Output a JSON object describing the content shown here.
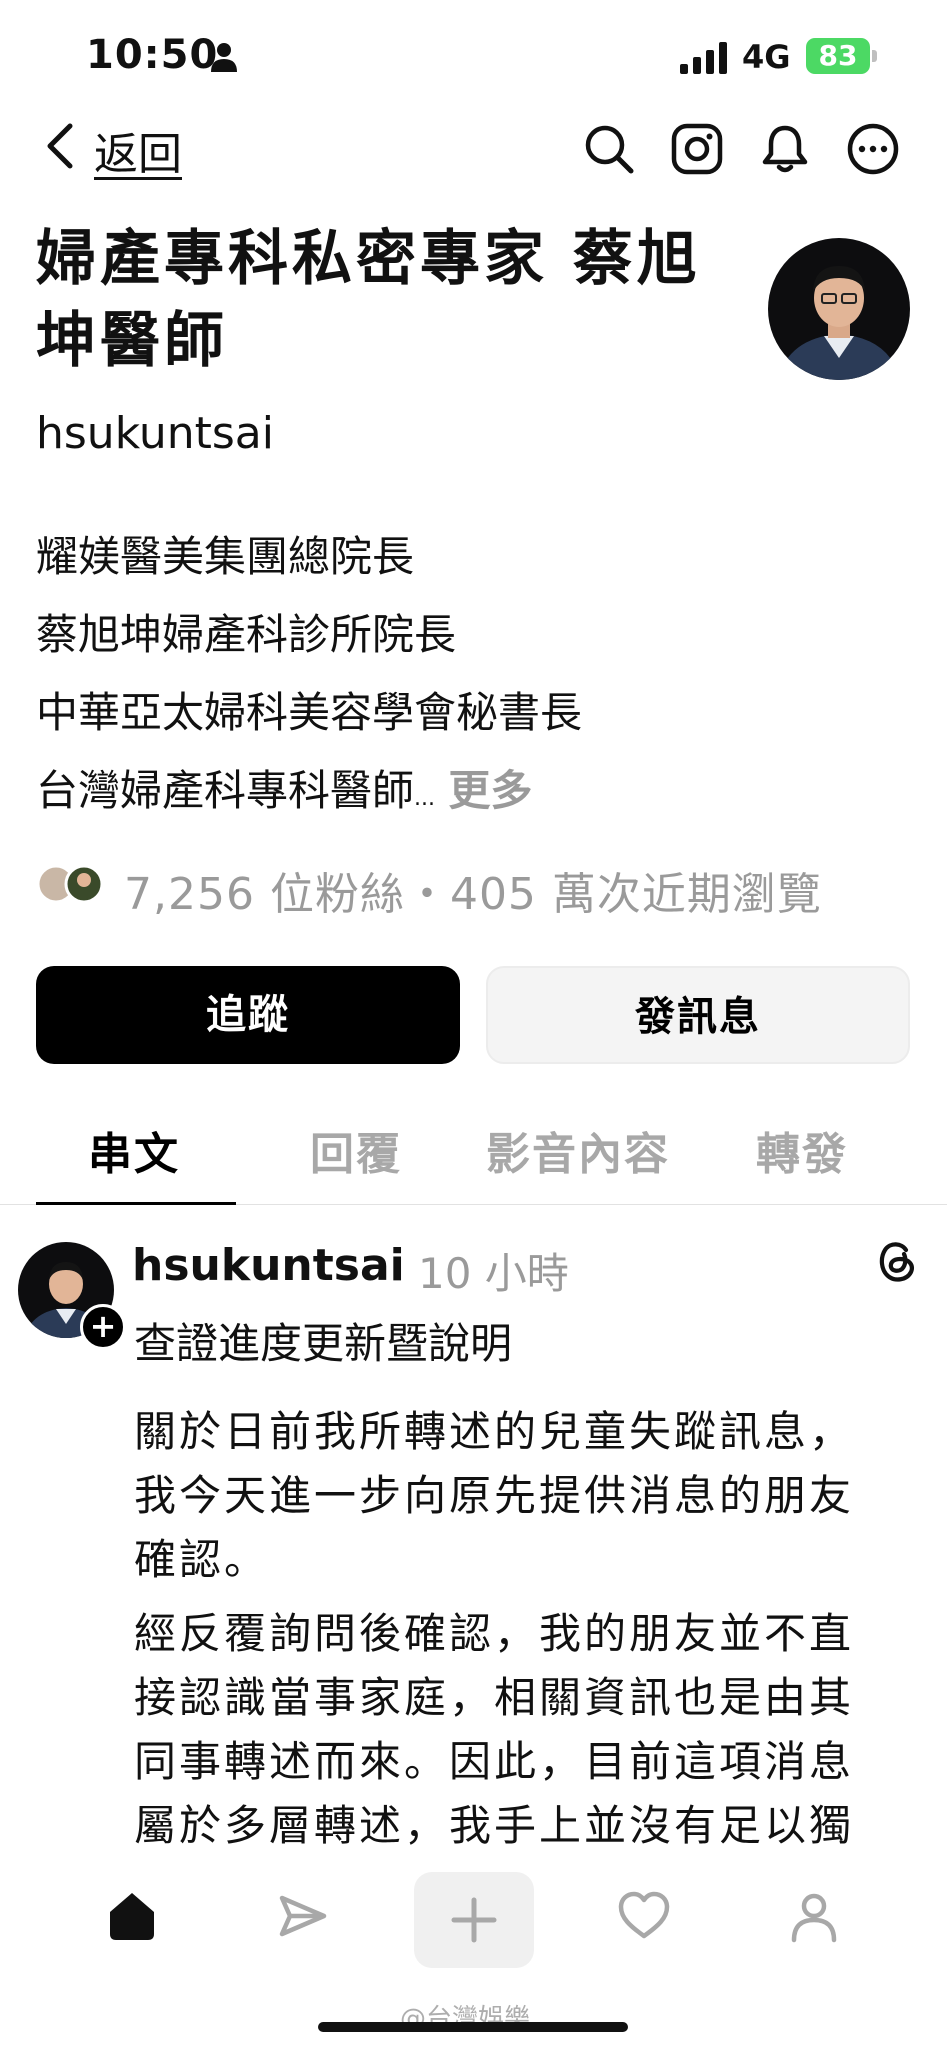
{
  "status_bar": {
    "time": "10:50",
    "network": "4G",
    "battery": "83"
  },
  "nav": {
    "back_label": "返回"
  },
  "profile": {
    "name_line1": "婦產專科私密專家 蔡旭",
    "name_line2": "坤醫師",
    "username": "hsukuntsai",
    "bio": [
      "耀媄醫美集團總院長",
      "蔡旭坤婦產科診所院長",
      "中華亞太婦科美容學會秘書長",
      "台灣婦產科專科醫師"
    ],
    "bio_ellipsis": "...",
    "bio_more": "更多",
    "stats": "7,256 位粉絲・405 萬次近期瀏覽"
  },
  "actions": {
    "follow_label": "追蹤",
    "message_label": "發訊息"
  },
  "tabs": [
    {
      "label": "串文",
      "active": true
    },
    {
      "label": "回覆",
      "active": false
    },
    {
      "label": "影音內容",
      "active": false
    },
    {
      "label": "轉發",
      "active": false
    }
  ],
  "post": {
    "username": "hsukuntsai",
    "time": "10 小時",
    "title": "查證進度更新暨說明",
    "paragraph1": [
      "關於日前我所轉述的兒童失蹤訊息，",
      "我今天進一步向原先提供消息的朋友",
      "確認。"
    ],
    "paragraph2": [
      "經反覆詢問後確認，我的朋友並不直",
      "接認識當事家庭，相關資訊也是由其",
      "同事轉述而來。因此，目前這項消息",
      "屬於多層轉述，我手上並沒有足以獨"
    ]
  },
  "watermark": "@台灣娛樂",
  "colors": {
    "accent": "#000000",
    "muted": "#9a9a9a",
    "battery": "#4cd964"
  }
}
